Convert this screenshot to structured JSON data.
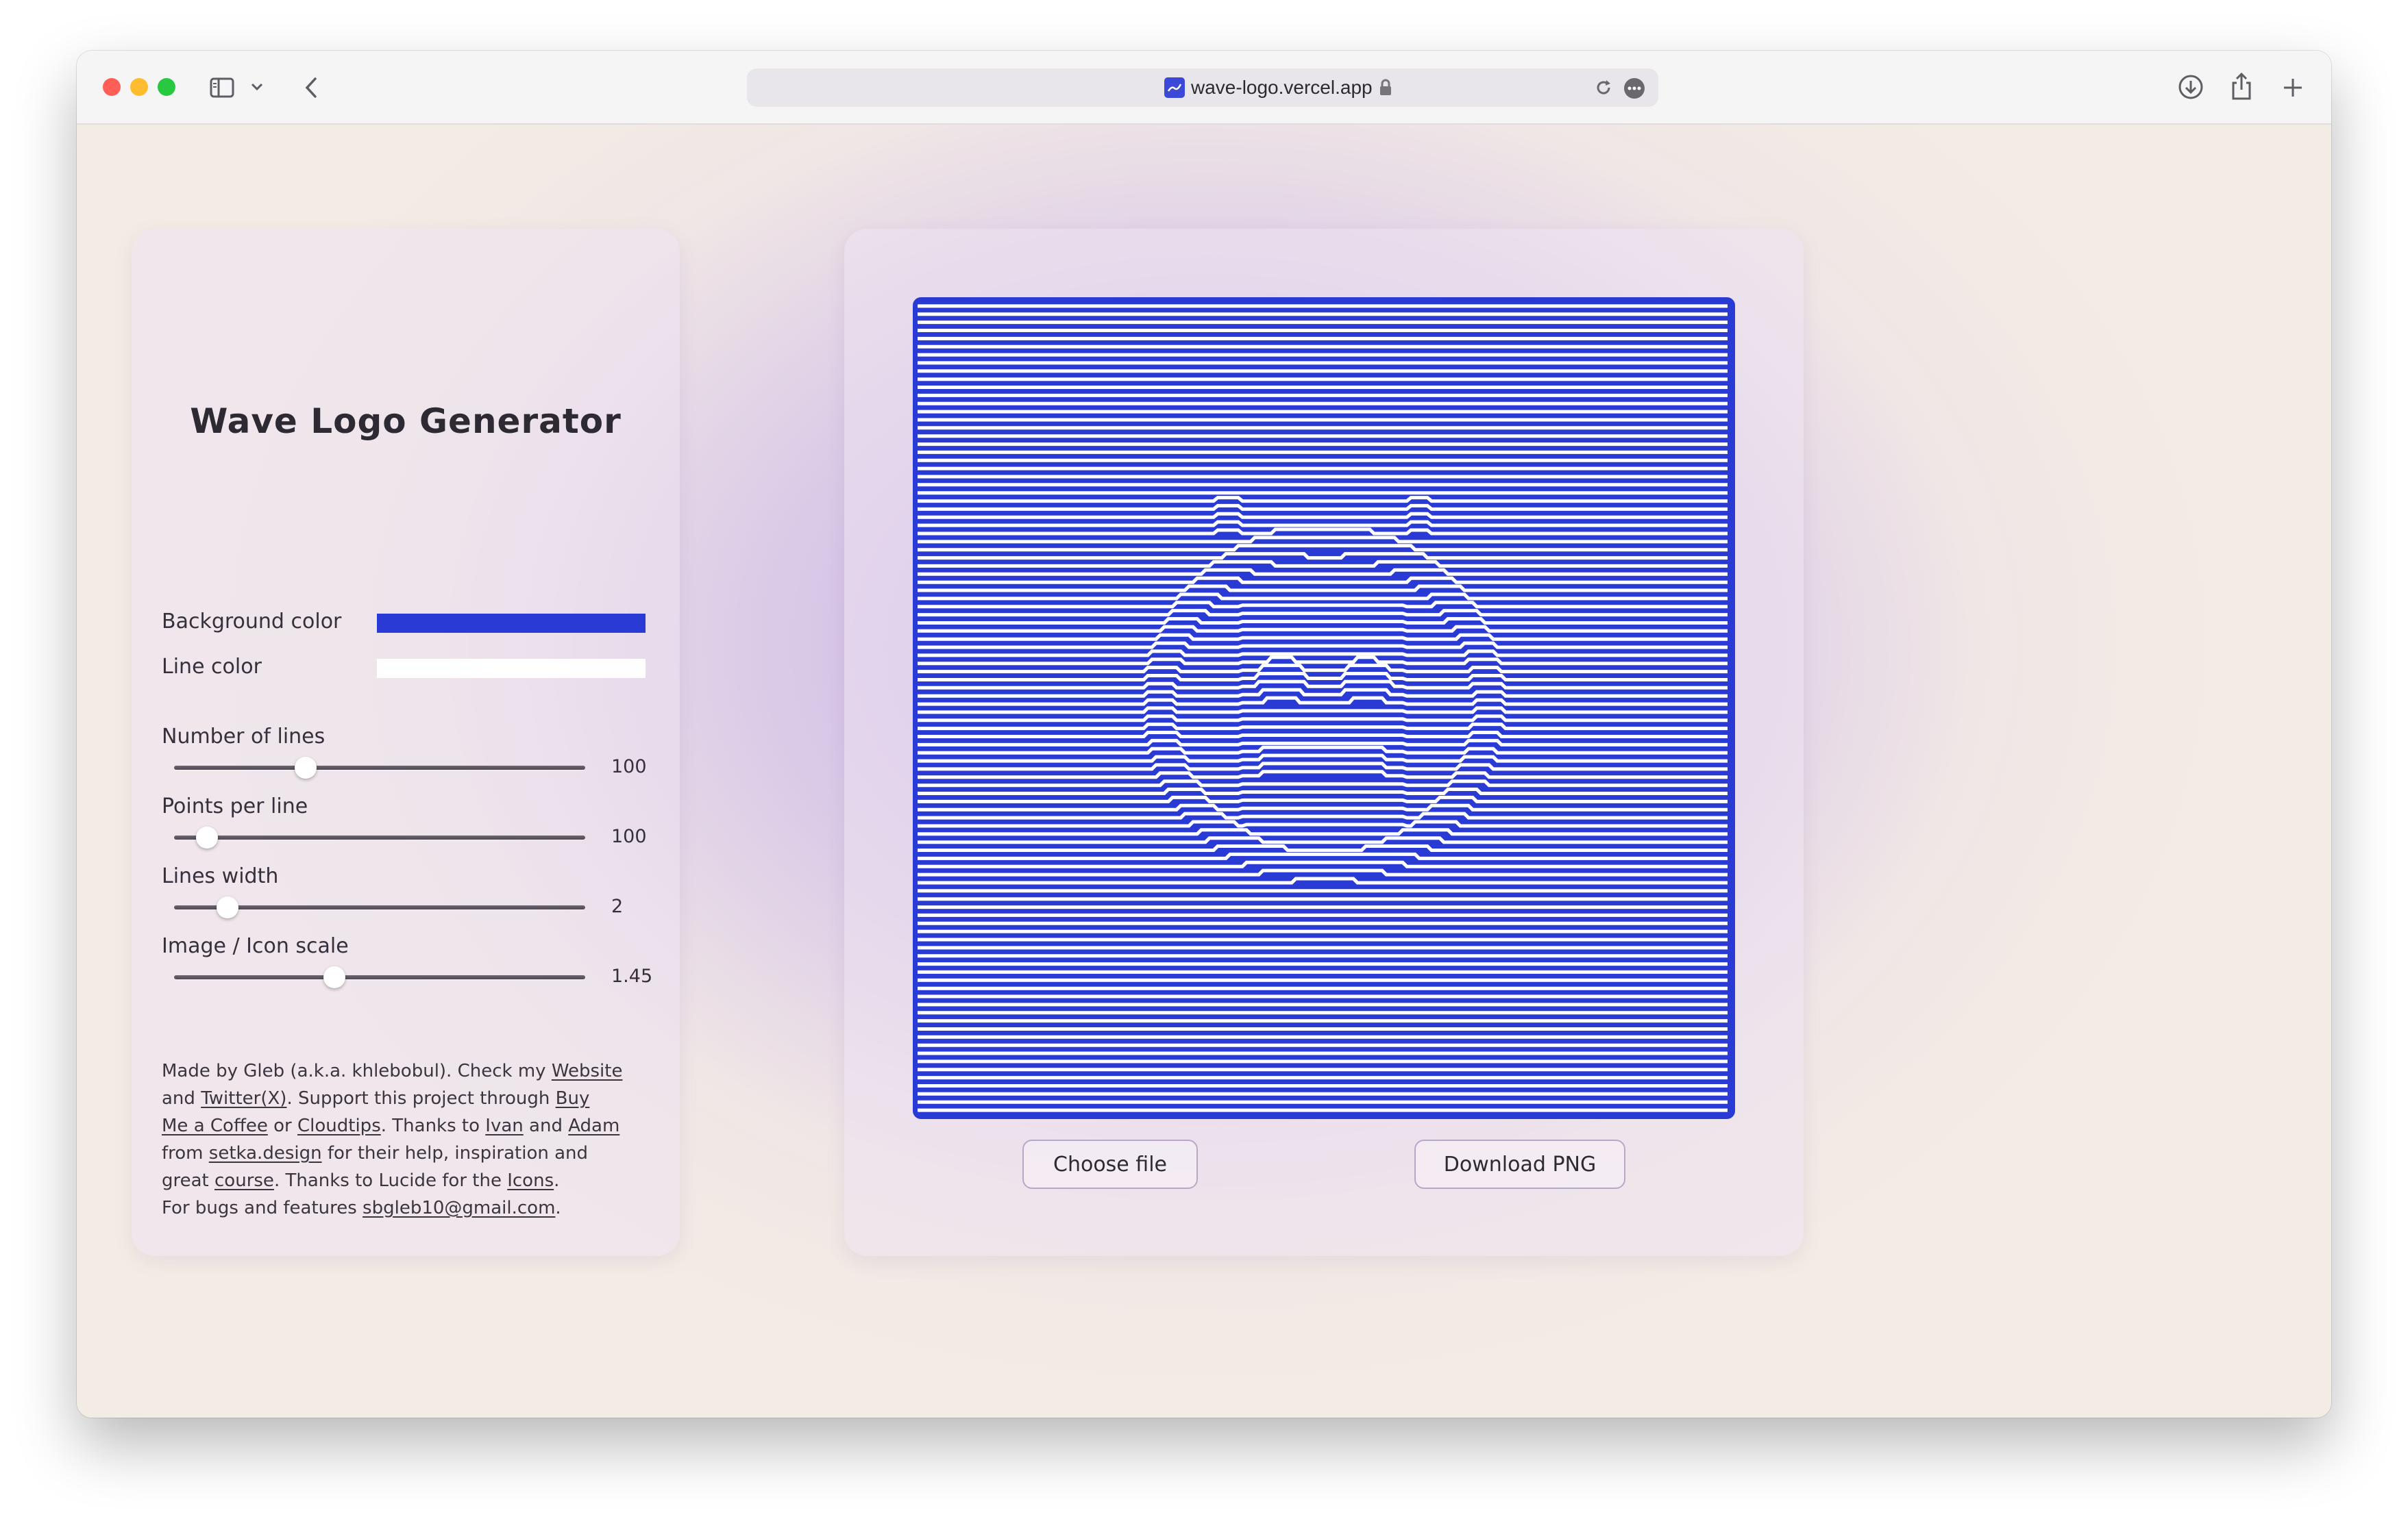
{
  "browser": {
    "url": "wave-logo.vercel.app",
    "icons": [
      "sidebar-icon",
      "chevron-down-icon",
      "back-icon",
      "site-icon",
      "lock-icon",
      "reload-icon",
      "more-icon",
      "download-icon",
      "share-icon",
      "new-tab-icon"
    ]
  },
  "app": {
    "title": "Wave Logo Generator",
    "colors": {
      "background_label": "Background color",
      "background_value": "#2a3ad4",
      "line_label": "Line color",
      "line_value": "#ffffff"
    },
    "sliders": [
      {
        "label": "Number of lines",
        "value": "100",
        "fraction": 0.32
      },
      {
        "label": "Points per line",
        "value": "100",
        "fraction": 0.08
      },
      {
        "label": "Lines width",
        "value": "2",
        "fraction": 0.13
      },
      {
        "label": "Image / Icon scale",
        "value": "1.45",
        "fraction": 0.39
      }
    ],
    "credits": {
      "t1": "Made by Gleb (a.k.a. khlebobul). Check my ",
      "website": "Website",
      "t2": "and ",
      "twitter": "Twitter(X)",
      "t3": ". Support this project through ",
      "buy": "Buy",
      "coffee": "Me a Coffee",
      "t4": " or ",
      "cloudtips": "Cloudtips",
      "t5": ". Thanks to ",
      "ivan": "Ivan",
      "t6": " and ",
      "adam": "Adam",
      "t7": "from ",
      "setka": "setka.design",
      "t8": " for their help, inspiration and",
      "t9": "great ",
      "course": "course",
      "t10": ". Thanks to Lucide for the ",
      "icons": "Icons",
      "t11": ".",
      "t12": "For bugs and features ",
      "email": "sbgleb10@gmail.com",
      "t13": "."
    },
    "buttons": {
      "choose_file": "Choose file",
      "download_png": "Download PNG"
    }
  }
}
